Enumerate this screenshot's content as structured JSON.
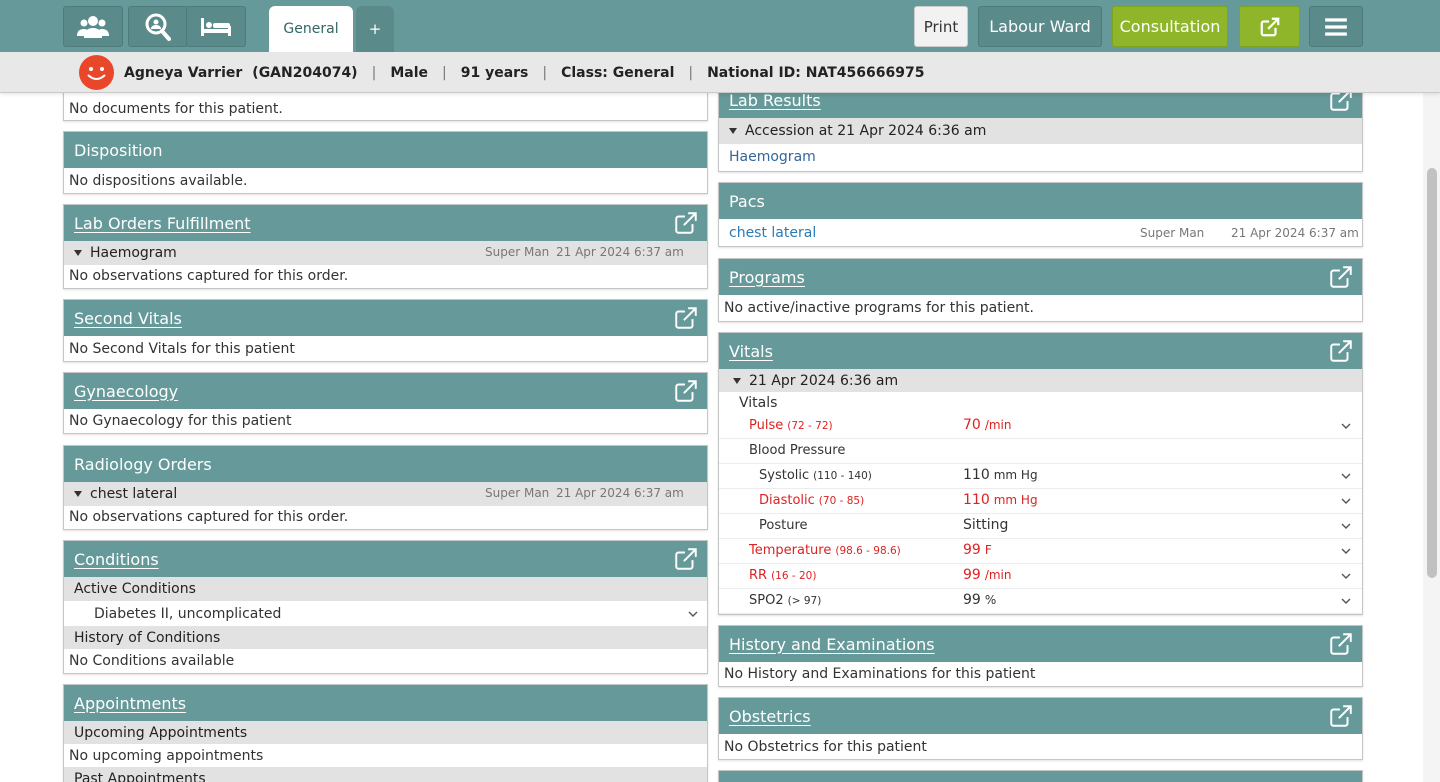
{
  "header": {
    "icons": [
      "patients-icon",
      "search-patient-icon",
      "bed-icon"
    ],
    "tabs": [
      {
        "label": "General"
      },
      {
        "label": "+"
      }
    ],
    "print_label": "Print",
    "labour_ward_label": "Labour Ward",
    "consultation_label": "Consultation",
    "external_icon": "external-link-icon",
    "menu_icon": "hamburger-menu-icon"
  },
  "patient": {
    "name": "Agneya Varrier",
    "id": "(GAN204074)",
    "gender": "Male",
    "age": "91 years",
    "class": "Class: General",
    "national_id": "National ID: NAT456666975"
  },
  "left": {
    "documents": {
      "empty": "No documents for this patient."
    },
    "disposition": {
      "title": "Disposition",
      "empty": "No dispositions available."
    },
    "lab_orders": {
      "title": "Lab Orders Fulfillment",
      "order": "Haemogram",
      "by": "Super Man",
      "date": "21 Apr 2024 6:37 am",
      "empty": "No observations captured for this order."
    },
    "second_vitals": {
      "title": "Second Vitals",
      "empty": "No Second Vitals for this patient"
    },
    "gynaecology": {
      "title": "Gynaecology",
      "empty": "No Gynaecology for this patient"
    },
    "radiology": {
      "title": "Radiology Orders",
      "order": "chest lateral",
      "by": "Super Man",
      "date": "21 Apr 2024 6:37 am",
      "empty": "No observations captured for this order."
    },
    "conditions": {
      "title": "Conditions",
      "active_label": "Active Conditions",
      "active_item": "Diabetes II, uncomplicated",
      "history_label": "History of Conditions",
      "empty": "No Conditions available"
    },
    "appointments": {
      "title": "Appointments",
      "upcoming_label": "Upcoming Appointments",
      "upcoming_empty": "No upcoming appointments",
      "past_label": "Past Appointments"
    }
  },
  "right": {
    "lab_results": {
      "title": "Lab Results",
      "accession": "Accession at 21 Apr 2024 6:36 am",
      "item": "Haemogram"
    },
    "pacs": {
      "title": "Pacs",
      "item": "chest lateral",
      "by": "Super Man",
      "date": "21 Apr 2024 6:37 am"
    },
    "programs": {
      "title": "Programs",
      "empty": "No active/inactive programs for this patient."
    },
    "vitals": {
      "title": "Vitals",
      "date": "21 Apr 2024 6:36 am",
      "group": "Vitals",
      "bp_label": "Blood Pressure",
      "rows": [
        {
          "label": "Pulse",
          "range": "(72 - 72)",
          "value": "70",
          "unit": "/min",
          "abnormal": true
        },
        {
          "label": "Systolic",
          "range": "(110 - 140)",
          "value": "110",
          "unit": "mm Hg",
          "abnormal": false
        },
        {
          "label": "Diastolic",
          "range": "(70 - 85)",
          "value": "110",
          "unit": "mm Hg",
          "abnormal": true
        },
        {
          "label": "Posture",
          "range": "",
          "value": "Sitting",
          "unit": "",
          "abnormal": false
        },
        {
          "label": "Temperature",
          "range": "(98.6 - 98.6)",
          "value": "99",
          "unit": "F",
          "abnormal": true
        },
        {
          "label": "RR",
          "range": "(16 - 20)",
          "value": "99",
          "unit": "/min",
          "abnormal": true
        },
        {
          "label": "SPO2",
          "range": "(> 97)",
          "value": "99",
          "unit": "%",
          "abnormal": false
        }
      ]
    },
    "history": {
      "title": "History and Examinations",
      "empty": "No History and Examinations for this patient"
    },
    "obstetrics": {
      "title": "Obstetrics",
      "empty": "No Obstetrics for this patient"
    }
  },
  "colors": {
    "header": "#669999",
    "consult": "#8fb62a",
    "abnormal": "#dd2222",
    "link": "#336699"
  }
}
